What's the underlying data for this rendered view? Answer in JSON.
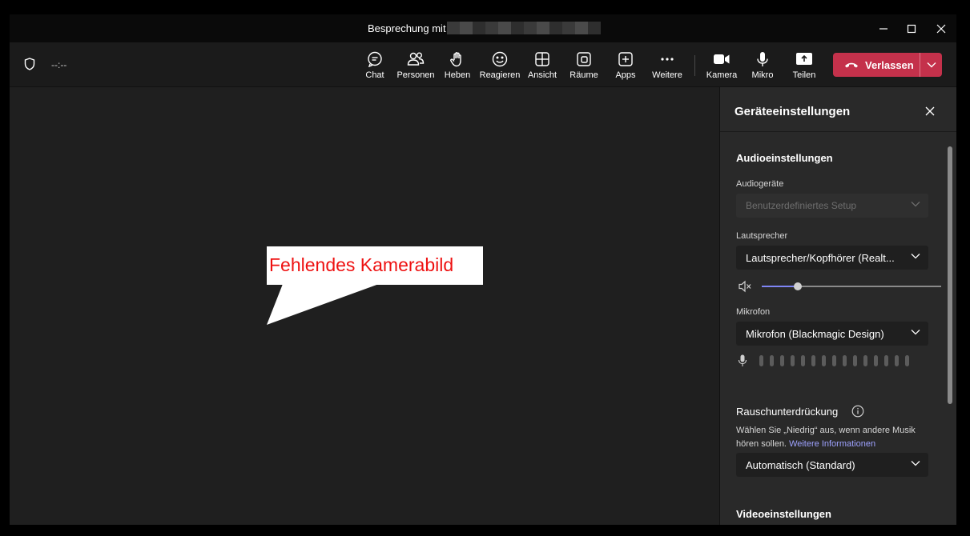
{
  "window": {
    "title": "Besprechung mit"
  },
  "toolbar": {
    "timer": "--:--",
    "items": [
      {
        "label": "Chat",
        "icon": "chat-icon"
      },
      {
        "label": "Personen",
        "icon": "people-icon"
      },
      {
        "label": "Heben",
        "icon": "raise-hand-icon"
      },
      {
        "label": "Reagieren",
        "icon": "smiley-icon"
      },
      {
        "label": "Ansicht",
        "icon": "grid-icon"
      },
      {
        "label": "Räume",
        "icon": "rooms-icon"
      },
      {
        "label": "Apps",
        "icon": "plus-square-icon"
      },
      {
        "label": "Weitere",
        "icon": "more-icon"
      },
      {
        "label": "Kamera",
        "icon": "camera-icon"
      },
      {
        "label": "Mikro",
        "icon": "microphone-icon"
      },
      {
        "label": "Teilen",
        "icon": "share-icon"
      }
    ],
    "leave_label": "Verlassen",
    "leave_color": "#c4314b"
  },
  "annotation": {
    "text": "Fehlendes Kamerabild",
    "color": "#ee1111"
  },
  "panel": {
    "title": "Geräteeinstellungen",
    "audio_section": "Audioeinstellungen",
    "audio_devices_label": "Audiogeräte",
    "audio_devices_value": "Benutzerdefiniertes Setup",
    "speaker_label": "Lautsprecher",
    "speaker_value": "Lautsprecher/Kopfhörer (Realt...",
    "speaker_volume": 0.2,
    "mic_label": "Mikrofon",
    "mic_value": "Mikrofon (Blackmagic Design)",
    "mic_level": 0,
    "noise_label": "Rauschunterdrückung",
    "noise_info": "Wählen Sie „Niedrig“ aus, wenn andere Musik hören sollen.",
    "noise_link": "Weitere Informationen",
    "noise_value": "Automatisch (Standard)",
    "video_section": "Videoeinstellungen",
    "accent_color": "#7f85f5"
  }
}
